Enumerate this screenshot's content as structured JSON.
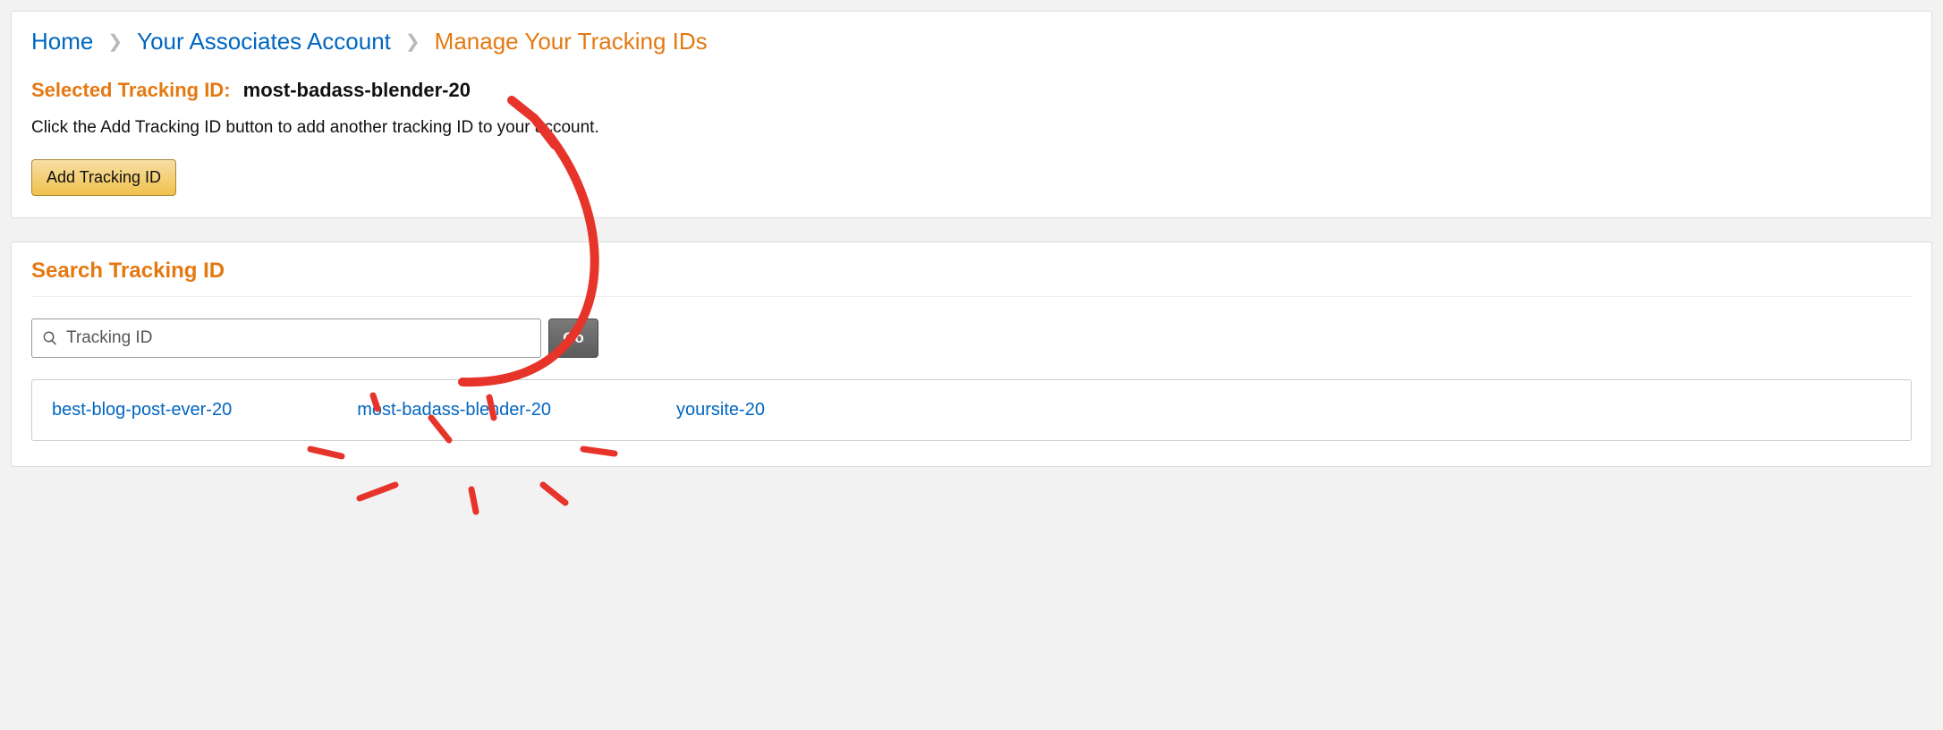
{
  "breadcrumb": {
    "home": "Home",
    "account": "Your Associates Account",
    "current": "Manage Your Tracking IDs"
  },
  "selected": {
    "label": "Selected Tracking ID:",
    "value": "most-badass-blender-20"
  },
  "instruction": "Click the Add Tracking ID button to add another tracking ID to your account.",
  "buttons": {
    "add": "Add Tracking ID",
    "go": "Go"
  },
  "search": {
    "title": "Search Tracking ID",
    "placeholder": "Tracking ID"
  },
  "results": [
    "best-blog-post-ever-20",
    "most-badass-blender-20",
    "yoursite-20"
  ]
}
